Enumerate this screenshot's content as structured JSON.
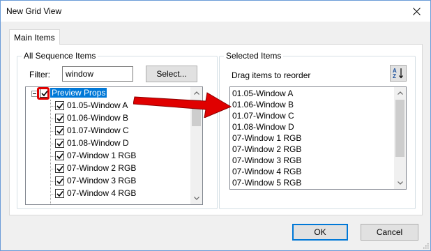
{
  "window": {
    "title": "New Grid View"
  },
  "tabs": [
    {
      "label": "Main Items"
    }
  ],
  "left_group": {
    "legend": "All Sequence Items",
    "filter_label": "Filter:",
    "filter_value": "window",
    "select_button": "Select...",
    "tree": [
      {
        "label": "Preview Props",
        "checked": true,
        "selected": true,
        "level": 0
      },
      {
        "label": "01.05-Window A",
        "checked": true,
        "level": 1
      },
      {
        "label": "01.06-Window B",
        "checked": true,
        "level": 1
      },
      {
        "label": "01.07-Window C",
        "checked": true,
        "level": 1
      },
      {
        "label": "01.08-Window D",
        "checked": true,
        "level": 1
      },
      {
        "label": "07-Window 1 RGB",
        "checked": true,
        "level": 1
      },
      {
        "label": "07-Window 2 RGB",
        "checked": true,
        "level": 1
      },
      {
        "label": "07-Window 3 RGB",
        "checked": true,
        "level": 1
      },
      {
        "label": "07-Window 4 RGB",
        "checked": true,
        "level": 1
      }
    ]
  },
  "right_group": {
    "legend": "Selected Items",
    "drag_label": "Drag items to reorder",
    "sort_icon": "sort-az-icon",
    "items": [
      "01.05-Window A",
      "01.06-Window B",
      "01.07-Window C",
      "01.08-Window D",
      "07-Window 1 RGB",
      "07-Window 2 RGB",
      "07-Window 3 RGB",
      "07-Window 4 RGB",
      "07-Window 5 RGB"
    ]
  },
  "buttons": {
    "ok": "OK",
    "cancel": "Cancel"
  },
  "colors": {
    "accent": "#0078d7",
    "annotation_red": "#e00000"
  }
}
